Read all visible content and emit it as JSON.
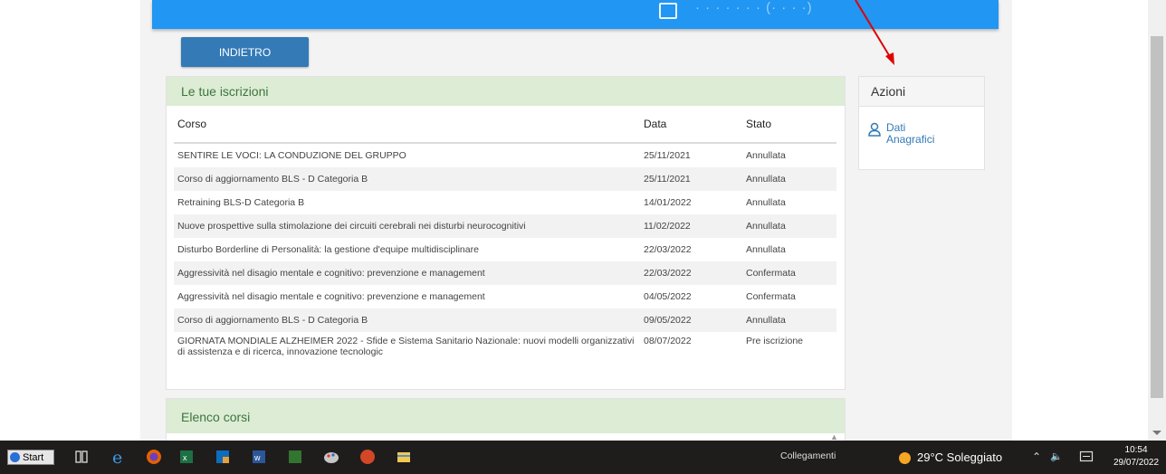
{
  "page": {
    "back_button": "INDIETRO",
    "topbar_blurred": "· · · · · · · (· · · ·)"
  },
  "enrollments": {
    "title": "Le tue iscrizioni",
    "headers": {
      "course": "Corso",
      "date": "Data",
      "status": "Stato"
    },
    "rows": [
      {
        "course": "SENTIRE LE VOCI: LA CONDUZIONE DEL GRUPPO",
        "date": "25/11/2021",
        "status": "Annullata"
      },
      {
        "course": "Corso di aggiornamento BLS - D Categoria B",
        "date": "25/11/2021",
        "status": "Annullata"
      },
      {
        "course": "Retraining BLS-D Categoria B",
        "date": "14/01/2022",
        "status": "Annullata"
      },
      {
        "course": "Nuove prospettive sulla stimolazione dei circuiti cerebrali nei disturbi neurocognitivi",
        "date": "11/02/2022",
        "status": "Annullata"
      },
      {
        "course": "Disturbo Borderline di Personalità: la gestione d'equipe multidisciplinare",
        "date": "22/03/2022",
        "status": "Annullata"
      },
      {
        "course": "Aggressività nel disagio mentale e cognitivo: prevenzione e management",
        "date": "22/03/2022",
        "status": "Confermata"
      },
      {
        "course": "Aggressività nel disagio mentale e cognitivo: prevenzione e management",
        "date": "04/05/2022",
        "status": "Confermata"
      },
      {
        "course": "Corso di aggiornamento BLS - D Categoria B",
        "date": "09/05/2022",
        "status": "Annullata"
      },
      {
        "course": "GIORNATA MONDIALE ALZHEIMER 2022 - Sfide e Sistema Sanitario Nazionale: nuovi modelli organizzativi di assistenza e di ricerca, innovazione tecnologic",
        "date": "08/07/2022",
        "status": "Pre iscrizione"
      }
    ]
  },
  "actions": {
    "title": "Azioni",
    "link_label": "Dati Anagrafici"
  },
  "courses": {
    "title": "Elenco corsi"
  },
  "taskbar": {
    "start_label": "Start",
    "links_label": "Collegamenti",
    "weather": "29°C  Soleggiato",
    "time": "10:54",
    "date": "29/07/2022"
  },
  "colors": {
    "topbar": "#2196f3",
    "button": "#337ab7",
    "panel_header": "#ddecd5",
    "panel_header_text": "#3c763d",
    "annotation_arrow": "#e00000"
  }
}
